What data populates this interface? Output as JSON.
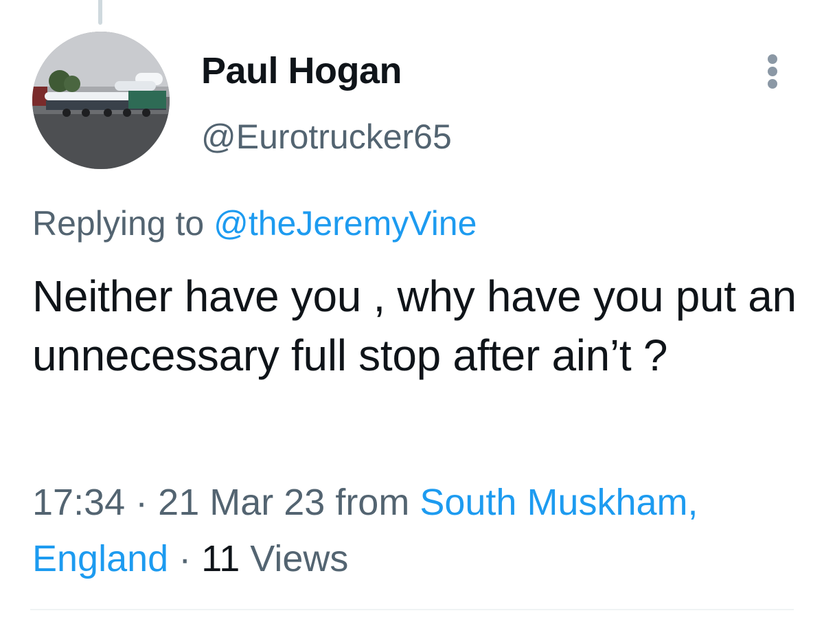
{
  "tweet": {
    "author": {
      "display_name": "Paul Hogan",
      "handle": "@Eurotrucker65"
    },
    "replying_to": {
      "prefix": "Replying to",
      "mention": "@theJeremyVine"
    },
    "text": "Neither have you , why have you put an unnecessary full stop after ain’t ?",
    "time": "17:34",
    "date": "21 Mar 23",
    "from_label": "from",
    "location_part1": "South Muskham,",
    "location_part2": "England",
    "separator": "·",
    "views_count": "11",
    "views_label": "Views",
    "icons": {
      "more": "more-vertical-icon",
      "avatar": "avatar-image"
    },
    "colors": {
      "link": "#1d9bf0",
      "secondary": "#536471",
      "primary": "#0f1419"
    }
  }
}
